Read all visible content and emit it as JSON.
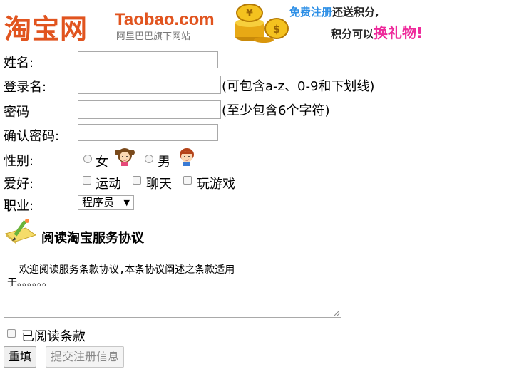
{
  "header": {
    "logo_cn": "淘宝网",
    "logo_en": "Taobao.com",
    "logo_sub": "阿里巴巴旗下网站",
    "banner_free": "免费注册",
    "banner_rest1": "还送积分,",
    "banner_line2a": "积分可以",
    "banner_gift": "换礼物",
    "banner_bang": "!"
  },
  "form": {
    "name_label": "姓名:",
    "login_label": "登录名:",
    "login_hint": "(可包含a-z、0-9和下划线)",
    "password_label": "密码",
    "password_hint": "(至少包含6个字符)",
    "confirm_label": "确认密码:",
    "gender_label": "性别:",
    "gender_options": [
      "女",
      "男"
    ],
    "hobby_label": "爱好:",
    "hobby_options": [
      "运动",
      "聊天",
      "玩游戏"
    ],
    "job_label": "职业:",
    "job_selected": "程序员"
  },
  "agreement": {
    "title": "阅读淘宝服务协议",
    "text": "欢迎阅读服务条款协议,本条协议阐述之条款适用\n于。。。。。。",
    "read_label": "已阅读条款"
  },
  "buttons": {
    "reset": "重填",
    "submit": "提交注册信息"
  },
  "colors": {
    "brand_orange": "#e1541f",
    "free_blue": "#2d8fe6",
    "gift_pink": "#ee2a9b"
  }
}
